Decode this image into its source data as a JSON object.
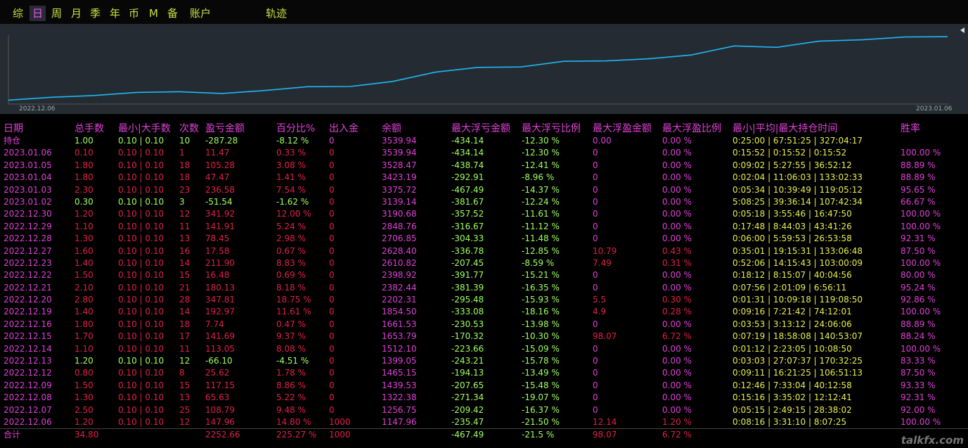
{
  "toolbar": {
    "items": [
      "综",
      "日",
      "周",
      "月",
      "季",
      "年",
      "币",
      "M",
      "备",
      "账户",
      "轨迹"
    ]
  },
  "chart_data": {
    "type": "line",
    "x_start_label": "2022.12.06",
    "x_end_label": "2023.01.06",
    "x": [
      "2022.12.06",
      "2022.12.07",
      "2022.12.08",
      "2022.12.09",
      "2022.12.12",
      "2022.12.13",
      "2022.12.14",
      "2022.12.15",
      "2022.12.16",
      "2022.12.19",
      "2022.12.20",
      "2022.12.21",
      "2022.12.22",
      "2022.12.23",
      "2022.12.27",
      "2022.12.28",
      "2022.12.29",
      "2022.12.30",
      "2023.01.02",
      "2023.01.03",
      "2023.01.04",
      "2023.01.05",
      "2023.01.06"
    ],
    "values": [
      1147.96,
      1256.75,
      1322.38,
      1439.53,
      1465.15,
      1399.05,
      1512.1,
      1653.79,
      1661.53,
      1854.5,
      2202.31,
      2382.44,
      2398.92,
      2610.82,
      2628.4,
      2706.85,
      2848.76,
      3190.68,
      3139.14,
      3375.72,
      3423.19,
      3528.47,
      3539.94
    ],
    "color": "#20b8f0",
    "ylim": [
      1000,
      3650
    ]
  },
  "table": {
    "headers": {
      "date": "日期",
      "total": "总手数",
      "minmax": "最小|大手数",
      "count": "次数",
      "pnl": "盈亏金额",
      "pct": "百分比%",
      "flow": "出入金",
      "balance": "余额",
      "max_float_loss": "最大浮亏金额",
      "max_float_loss_pct": "最大浮亏比例",
      "max_float_profit": "最大浮盈金额",
      "max_float_profit_pct": "最大浮盈比例",
      "hold_time": "最小|平均|最大持仓时间",
      "win_rate": "胜率"
    },
    "rows": [
      {
        "cls": "holding",
        "date": "持仓",
        "total": "1.00",
        "minmax": "0.10 | 0.10",
        "count": "10",
        "pnl": "-287.28",
        "pct": "-8.12 %",
        "flow": "0",
        "balance": "3539.94",
        "mfl": "-434.14",
        "mflp": "-12.30 %",
        "mfp": "0.00",
        "mfpp": "0.00 %",
        "time": "0:25:00 | 67:51:25 | 327:04:17",
        "win": ""
      },
      {
        "cls": "pos",
        "date": "2023.01.06",
        "total": "0.10",
        "minmax": "0.10 | 0.10",
        "count": "1",
        "pnl": "11.47",
        "pct": "0.33 %",
        "flow": "0",
        "balance": "3539.94",
        "mfl": "-434.14",
        "mflp": "-12.30 %",
        "mfp": "0",
        "mfpp": "0.00 %",
        "time": "0:15:52 | 0:15:52 | 0:15:52",
        "win": "100.00 %"
      },
      {
        "cls": "pos",
        "date": "2023.01.05",
        "total": "1.80",
        "minmax": "0.10 | 0.10",
        "count": "18",
        "pnl": "105.28",
        "pct": "3.08 %",
        "flow": "0",
        "balance": "3528.47",
        "mfl": "-438.74",
        "mflp": "-12.41 %",
        "mfp": "0",
        "mfpp": "0.00 %",
        "time": "0:09:02 | 5:27:55 | 36:52:12",
        "win": "88.89 %"
      },
      {
        "cls": "pos",
        "date": "2023.01.04",
        "total": "1.80",
        "minmax": "0.10 | 0.10",
        "count": "18",
        "pnl": "47.47",
        "pct": "1.41 %",
        "flow": "0",
        "balance": "3423.19",
        "mfl": "-292.91",
        "mflp": "-8.96 %",
        "mfp": "0",
        "mfpp": "0.00 %",
        "time": "0:02:04 | 11:06:03 | 133:02:33",
        "win": "88.89 %"
      },
      {
        "cls": "pos",
        "date": "2023.01.03",
        "total": "2.30",
        "minmax": "0.10 | 0.10",
        "count": "23",
        "pnl": "236.58",
        "pct": "7.54 %",
        "flow": "0",
        "balance": "3375.72",
        "mfl": "-467.49",
        "mflp": "-14.37 %",
        "mfp": "0",
        "mfpp": "0.00 %",
        "time": "0:05:34 | 10:39:49 | 119:05:12",
        "win": "95.65 %"
      },
      {
        "cls": "neg",
        "date": "2023.01.02",
        "total": "0.30",
        "minmax": "0.10 | 0.10",
        "count": "3",
        "pnl": "-51.54",
        "pct": "-1.62 %",
        "flow": "0",
        "balance": "3139.14",
        "mfl": "-381.67",
        "mflp": "-12.24 %",
        "mfp": "0",
        "mfpp": "0.00 %",
        "time": "5:08:25 | 39:36:14 | 107:42:34",
        "win": "66.67 %"
      },
      {
        "cls": "pos",
        "date": "2022.12.30",
        "total": "1.20",
        "minmax": "0.10 | 0.10",
        "count": "12",
        "pnl": "341.92",
        "pct": "12.00 %",
        "flow": "0",
        "balance": "3190.68",
        "mfl": "-357.52",
        "mflp": "-11.61 %",
        "mfp": "0",
        "mfpp": "0.00 %",
        "time": "0:05:18 | 3:55:46 | 16:47:50",
        "win": "100.00 %"
      },
      {
        "cls": "pos",
        "date": "2022.12.29",
        "total": "1.10",
        "minmax": "0.10 | 0.10",
        "count": "11",
        "pnl": "141.91",
        "pct": "5.24 %",
        "flow": "0",
        "balance": "2848.76",
        "mfl": "-316.67",
        "mflp": "-11.12 %",
        "mfp": "0",
        "mfpp": "0.00 %",
        "time": "0:17:48 | 8:44:03 | 43:41:26",
        "win": "100.00 %"
      },
      {
        "cls": "pos",
        "date": "2022.12.28",
        "total": "1.30",
        "minmax": "0.10 | 0.10",
        "count": "13",
        "pnl": "78.45",
        "pct": "2.98 %",
        "flow": "0",
        "balance": "2706.85",
        "mfl": "-304.33",
        "mflp": "-11.48 %",
        "mfp": "0",
        "mfpp": "0.00 %",
        "time": "0:06:00 | 5:59:53 | 26:53:58",
        "win": "92.31 %"
      },
      {
        "cls": "pos hot",
        "date": "2022.12.27",
        "total": "1.60",
        "minmax": "0.10 | 0.10",
        "count": "16",
        "pnl": "17.58",
        "pct": "0.67 %",
        "flow": "0",
        "balance": "2628.40",
        "mfl": "-336.78",
        "mflp": "-12.85 %",
        "mfp": "10.79",
        "mfpp": "0.43 %",
        "time": "0:35:01 | 19:15:31 | 133:06:48",
        "win": "87.50 %"
      },
      {
        "cls": "pos hot",
        "date": "2022.12.23",
        "total": "1.40",
        "minmax": "0.10 | 0.10",
        "count": "14",
        "pnl": "211.90",
        "pct": "8.83 %",
        "flow": "0",
        "balance": "2610.82",
        "mfl": "-207.45",
        "mflp": "-8.59 %",
        "mfp": "7.49",
        "mfpp": "0.31 %",
        "time": "0:52:06 | 14:15:43 | 103:00:09",
        "win": "100.00 %"
      },
      {
        "cls": "pos",
        "date": "2022.12.22",
        "total": "1.50",
        "minmax": "0.10 | 0.10",
        "count": "15",
        "pnl": "16.48",
        "pct": "0.69 %",
        "flow": "0",
        "balance": "2398.92",
        "mfl": "-391.77",
        "mflp": "-15.21 %",
        "mfp": "0",
        "mfpp": "0.00 %",
        "time": "0:18:12 | 8:15:07 | 40:04:56",
        "win": "80.00 %"
      },
      {
        "cls": "pos",
        "date": "2022.12.21",
        "total": "2.10",
        "minmax": "0.10 | 0.10",
        "count": "21",
        "pnl": "180.13",
        "pct": "8.18 %",
        "flow": "0",
        "balance": "2382.44",
        "mfl": "-381.39",
        "mflp": "-16.35 %",
        "mfp": "0",
        "mfpp": "0.00 %",
        "time": "0:07:56 | 2:01:09 | 6:56:11",
        "win": "95.24 %"
      },
      {
        "cls": "pos hot",
        "date": "2022.12.20",
        "total": "2.80",
        "minmax": "0.10 | 0.10",
        "count": "28",
        "pnl": "347.81",
        "pct": "18.75 %",
        "flow": "0",
        "balance": "2202.31",
        "mfl": "-295.48",
        "mflp": "-15.93 %",
        "mfp": "5.5",
        "mfpp": "0.30 %",
        "time": "0:01:31 | 10:09:18 | 119:08:50",
        "win": "92.86 %"
      },
      {
        "cls": "pos hot",
        "date": "2022.12.19",
        "total": "1.40",
        "minmax": "0.10 | 0.10",
        "count": "14",
        "pnl": "192.97",
        "pct": "11.61 %",
        "flow": "0",
        "balance": "1854.50",
        "mfl": "-333.08",
        "mflp": "-18.16 %",
        "mfp": "4.9",
        "mfpp": "0.28 %",
        "time": "0:09:16 | 7:21:42 | 74:12:01",
        "win": "100.00 %"
      },
      {
        "cls": "pos",
        "date": "2022.12.16",
        "total": "1.80",
        "minmax": "0.10 | 0.10",
        "count": "18",
        "pnl": "7.74",
        "pct": "0.47 %",
        "flow": "0",
        "balance": "1661.53",
        "mfl": "-230.53",
        "mflp": "-13.98 %",
        "mfp": "0",
        "mfpp": "0.00 %",
        "time": "0:03:53 | 3:13:12 | 24:06:06",
        "win": "88.89 %"
      },
      {
        "cls": "pos hot",
        "date": "2022.12.15",
        "total": "1.70",
        "minmax": "0.10 | 0.10",
        "count": "17",
        "pnl": "141.69",
        "pct": "9.37 %",
        "flow": "0",
        "balance": "1653.79",
        "mfl": "-170.32",
        "mflp": "-10.30 %",
        "mfp": "98.07",
        "mfpp": "6.72 %",
        "time": "0:07:19 | 18:58:08 | 140:53:07",
        "win": "88.24 %"
      },
      {
        "cls": "pos",
        "date": "2022.12.14",
        "total": "1.10",
        "minmax": "0.10 | 0.10",
        "count": "11",
        "pnl": "113.05",
        "pct": "8.08 %",
        "flow": "0",
        "balance": "1512.10",
        "mfl": "-223.66",
        "mflp": "-15.09 %",
        "mfp": "0",
        "mfpp": "0.00 %",
        "time": "0:01:12 | 2:23:05 | 10:08:50",
        "win": "100.00 %"
      },
      {
        "cls": "neg",
        "date": "2022.12.13",
        "total": "1.20",
        "minmax": "0.10 | 0.10",
        "count": "12",
        "pnl": "-66.10",
        "pct": "-4.51 %",
        "flow": "0",
        "balance": "1399.05",
        "mfl": "-243.21",
        "mflp": "-15.78 %",
        "mfp": "0",
        "mfpp": "0.00 %",
        "time": "0:03:03 | 27:07:37 | 170:32:25",
        "win": "83.33 %"
      },
      {
        "cls": "pos",
        "date": "2022.12.12",
        "total": "0.80",
        "minmax": "0.10 | 0.10",
        "count": "8",
        "pnl": "25.62",
        "pct": "1.78 %",
        "flow": "0",
        "balance": "1465.15",
        "mfl": "-194.13",
        "mflp": "-13.49 %",
        "mfp": "0",
        "mfpp": "0.00 %",
        "time": "0:09:11 | 16:21:25 | 106:51:13",
        "win": "87.50 %"
      },
      {
        "cls": "pos",
        "date": "2022.12.09",
        "total": "1.50",
        "minmax": "0.10 | 0.10",
        "count": "15",
        "pnl": "117.15",
        "pct": "8.86 %",
        "flow": "0",
        "balance": "1439.53",
        "mfl": "-207.65",
        "mflp": "-15.48 %",
        "mfp": "0",
        "mfpp": "0.00 %",
        "time": "0:12:46 | 7:33:04 | 40:12:58",
        "win": "93.33 %"
      },
      {
        "cls": "pos",
        "date": "2022.12.08",
        "total": "1.30",
        "minmax": "0.10 | 0.10",
        "count": "13",
        "pnl": "65.63",
        "pct": "5.22 %",
        "flow": "0",
        "balance": "1322.38",
        "mfl": "-271.34",
        "mflp": "-19.07 %",
        "mfp": "0",
        "mfpp": "0.00 %",
        "time": "0:15:16 | 3:35:02 | 12:12:41",
        "win": "92.31 %"
      },
      {
        "cls": "pos",
        "date": "2022.12.07",
        "total": "2.50",
        "minmax": "0.10 | 0.10",
        "count": "25",
        "pnl": "108.79",
        "pct": "9.48 %",
        "flow": "0",
        "balance": "1256.75",
        "mfl": "-209.42",
        "mflp": "-16.37 %",
        "mfp": "0",
        "mfpp": "0.00 %",
        "time": "0:05:15 | 2:49:15 | 28:38:02",
        "win": "92.00 %"
      },
      {
        "cls": "pos hot",
        "date": "2022.12.06",
        "total": "1.20",
        "minmax": "0.10 | 0.10",
        "count": "12",
        "pnl": "147.96",
        "pct": "14.80 %",
        "flow": "1000",
        "balance": "1147.96",
        "mfl": "-235.47",
        "mflp": "-21.50 %",
        "mfp": "12.14",
        "mfpp": "1.20 %",
        "time": "0:08:16 | 3:31:10 | 8:07:25",
        "win": "100.00 %"
      }
    ],
    "total": {
      "date": "合计",
      "total": "34.80",
      "pnl": "2252.66",
      "pct": "225.27 %",
      "flow": "1000",
      "mfl": "-467.49",
      "mflp": "-21.5 %",
      "mfp": "98.07",
      "mfpp": "6.72 %"
    }
  },
  "watermark": "talkfx.com"
}
